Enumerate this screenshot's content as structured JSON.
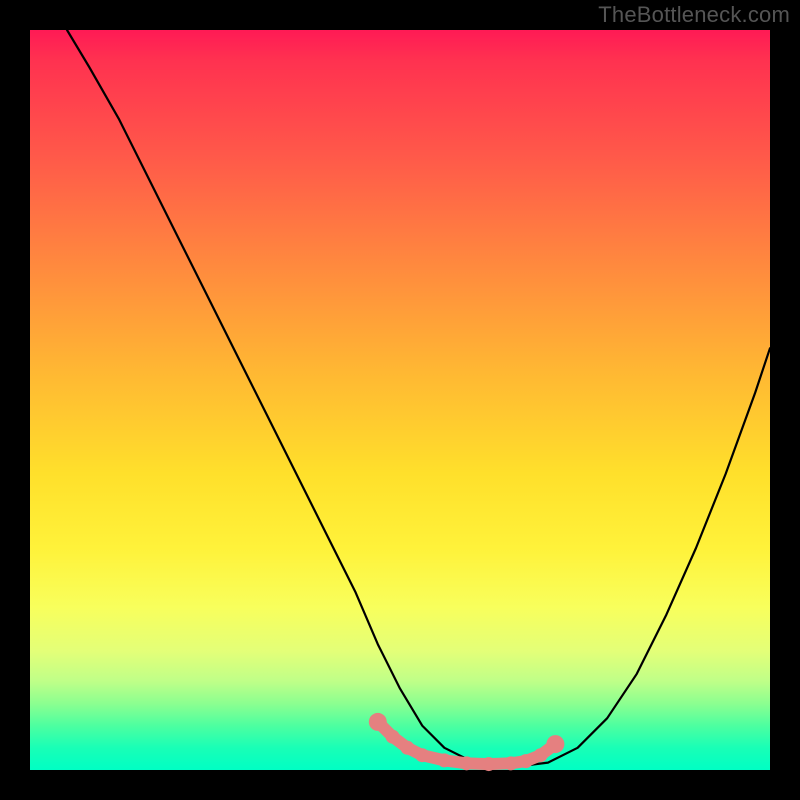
{
  "watermark": "TheBottleneck.com",
  "chart_data": {
    "type": "line",
    "title": "",
    "xlabel": "",
    "ylabel": "",
    "xlim": [
      0,
      100
    ],
    "ylim": [
      0,
      100
    ],
    "series": [
      {
        "name": "main-curve",
        "color": "#000000",
        "x": [
          5,
          8,
          12,
          16,
          20,
          24,
          28,
          32,
          36,
          40,
          44,
          47,
          50,
          53,
          56,
          60,
          64,
          66,
          70,
          74,
          78,
          82,
          86,
          90,
          94,
          98,
          100
        ],
        "y": [
          100,
          95,
          88,
          80,
          72,
          64,
          56,
          48,
          40,
          32,
          24,
          17,
          11,
          6,
          3,
          1,
          0.5,
          0.5,
          1,
          3,
          7,
          13,
          21,
          30,
          40,
          51,
          57
        ]
      },
      {
        "name": "highlight-low-bottleneck",
        "color": "#e58080",
        "x": [
          47,
          49,
          51,
          53,
          56,
          59,
          62,
          65,
          67,
          69,
          71
        ],
        "y": [
          6.5,
          4.5,
          3,
          2,
          1.3,
          0.9,
          0.8,
          0.9,
          1.2,
          2,
          3.5
        ]
      }
    ],
    "gradient_stops": [
      {
        "pos": 0.0,
        "color": "#ff1a55"
      },
      {
        "pos": 0.5,
        "color": "#ffd433"
      },
      {
        "pos": 0.8,
        "color": "#f4ff60"
      },
      {
        "pos": 1.0,
        "color": "#00ffc4"
      }
    ]
  }
}
